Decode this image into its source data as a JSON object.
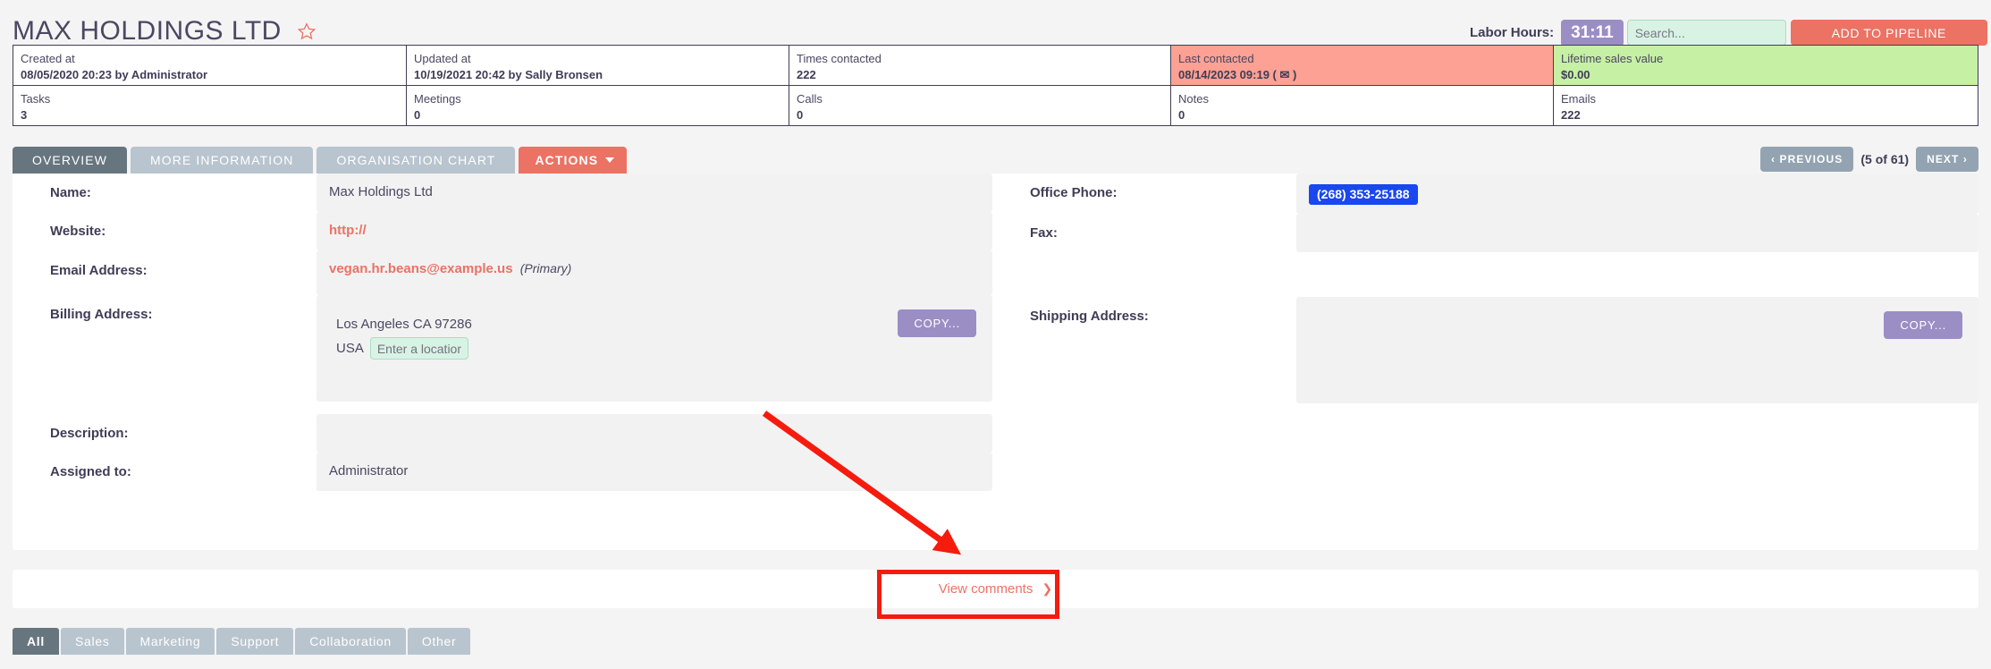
{
  "header": {
    "title": "MAX HOLDINGS LTD",
    "star_icon": "star-outline-icon",
    "labor_hours_label": "Labor Hours:",
    "labor_hours_value": "31:11",
    "search_placeholder": "Search...",
    "search_value": "",
    "add_to_pipeline_label": "ADD TO PIPELINE"
  },
  "stats": {
    "row1": [
      {
        "key": "Created at",
        "value": "08/05/2020 20:23 by Administrator",
        "highlight": "none"
      },
      {
        "key": "Updated at",
        "value": "10/19/2021 20:42 by Sally Bronsen",
        "highlight": "none"
      },
      {
        "key": "Times contacted",
        "value": "222",
        "highlight": "none"
      },
      {
        "key": "Last contacted",
        "value": "08/14/2023 09:19 ( ✉ )",
        "highlight": "pink"
      },
      {
        "key": "Lifetime sales value",
        "value": "$0.00",
        "highlight": "green"
      }
    ],
    "row2": [
      {
        "key": "Tasks",
        "value": "3",
        "highlight": "none"
      },
      {
        "key": "Meetings",
        "value": "0",
        "highlight": "none"
      },
      {
        "key": "Calls",
        "value": "0",
        "highlight": "none"
      },
      {
        "key": "Notes",
        "value": "0",
        "highlight": "none"
      },
      {
        "key": "Emails",
        "value": "222",
        "highlight": "none"
      }
    ]
  },
  "tabs": [
    {
      "label": "OVERVIEW",
      "state": "active"
    },
    {
      "label": "MORE INFORMATION",
      "state": "inactive"
    },
    {
      "label": "ORGANISATION CHART",
      "state": "inactive"
    },
    {
      "label": "ACTIONS",
      "state": "actions"
    }
  ],
  "pager": {
    "previous_label": "PREVIOUS",
    "next_label": "NEXT",
    "count_label": "(5 of 61)",
    "prev_icon": "chevron-left-icon",
    "next_icon": "chevron-right-icon"
  },
  "fields": {
    "name_label": "Name:",
    "name_value": "Max Holdings Ltd",
    "website_label": "Website:",
    "website_value": "http://",
    "email_label": "Email Address:",
    "email_value": "vegan.hr.beans@example.us",
    "email_primary_note": "(Primary)",
    "billing_label": "Billing Address:",
    "billing_city_line": "Los Angeles CA   97286",
    "billing_country": "USA",
    "billing_location_placeholder": "Enter a location",
    "billing_location_value": "",
    "billing_copy_label": "COPY...",
    "description_label": "Description:",
    "description_value": "",
    "assigned_label": "Assigned to:",
    "assigned_value": "Administrator",
    "office_phone_label": "Office Phone:",
    "office_phone_value": "(268) 353-25188",
    "fax_label": "Fax:",
    "fax_value": "",
    "shipping_label": "Shipping Address:",
    "shipping_value": "",
    "shipping_copy_label": "COPY..."
  },
  "comments": {
    "view_label": "View comments",
    "chevron_icon": "chevron-down-icon"
  },
  "bottom_tabs": [
    {
      "label": "All",
      "state": "active"
    },
    {
      "label": "Sales",
      "state": "inactive"
    },
    {
      "label": "Marketing",
      "state": "inactive"
    },
    {
      "label": "Support",
      "state": "inactive"
    },
    {
      "label": "Collaboration",
      "state": "inactive"
    },
    {
      "label": "Other",
      "state": "inactive"
    }
  ],
  "annotations": {
    "arrow_icon": "red-arrow-annotation",
    "box_icon": "red-highlight-box-annotation",
    "accent_coral": "#ec7263",
    "accent_purple": "#9b8ec4",
    "accent_slate": "#67757f",
    "accent_mint": "#d8f3e4",
    "highlight_pink": "#fca193",
    "highlight_green": "#c6f0a4",
    "selection_blue": "#1a47f0",
    "annotation_red": "#f51b0d"
  }
}
